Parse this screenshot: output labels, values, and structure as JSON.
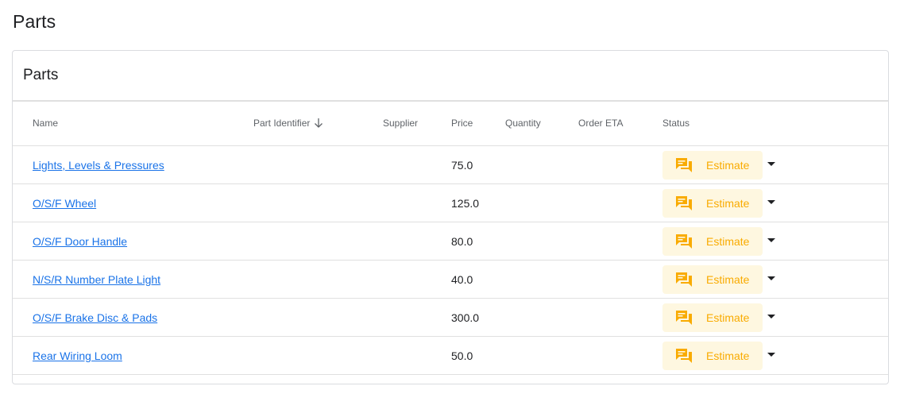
{
  "page": {
    "title": "Parts"
  },
  "card": {
    "title": "Parts"
  },
  "table": {
    "headers": {
      "name": "Name",
      "part_identifier": "Part Identifier",
      "supplier": "Supplier",
      "price": "Price",
      "quantity": "Quantity",
      "order_eta": "Order ETA",
      "status": "Status"
    },
    "sort": {
      "column": "part_identifier",
      "direction": "descending",
      "icon": "arrow-down-icon"
    },
    "rows": [
      {
        "name": "Lights, Levels & Pressures",
        "part_identifier": "",
        "supplier": "",
        "price": "75.0",
        "quantity": "",
        "order_eta": "",
        "status": "Estimate"
      },
      {
        "name": "O/S/F Wheel",
        "part_identifier": "",
        "supplier": "",
        "price": "125.0",
        "quantity": "",
        "order_eta": "",
        "status": "Estimate"
      },
      {
        "name": "O/S/F Door Handle",
        "part_identifier": "",
        "supplier": "",
        "price": "80.0",
        "quantity": "",
        "order_eta": "",
        "status": "Estimate"
      },
      {
        "name": "N/S/R Number Plate Light",
        "part_identifier": "",
        "supplier": "",
        "price": "40.0",
        "quantity": "",
        "order_eta": "",
        "status": "Estimate"
      },
      {
        "name": "O/S/F Brake Disc & Pads",
        "part_identifier": "",
        "supplier": "",
        "price": "300.0",
        "quantity": "",
        "order_eta": "",
        "status": "Estimate"
      },
      {
        "name": "Rear Wiring Loom",
        "part_identifier": "",
        "supplier": "",
        "price": "50.0",
        "quantity": "",
        "order_eta": "",
        "status": "Estimate"
      }
    ]
  },
  "status_style": {
    "icon": "chat-icon",
    "chip_color": "#fef7e0",
    "accent_color": "#f9ab00"
  },
  "colors": {
    "link": "#1a73e8",
    "border": "#e0e0e0"
  }
}
